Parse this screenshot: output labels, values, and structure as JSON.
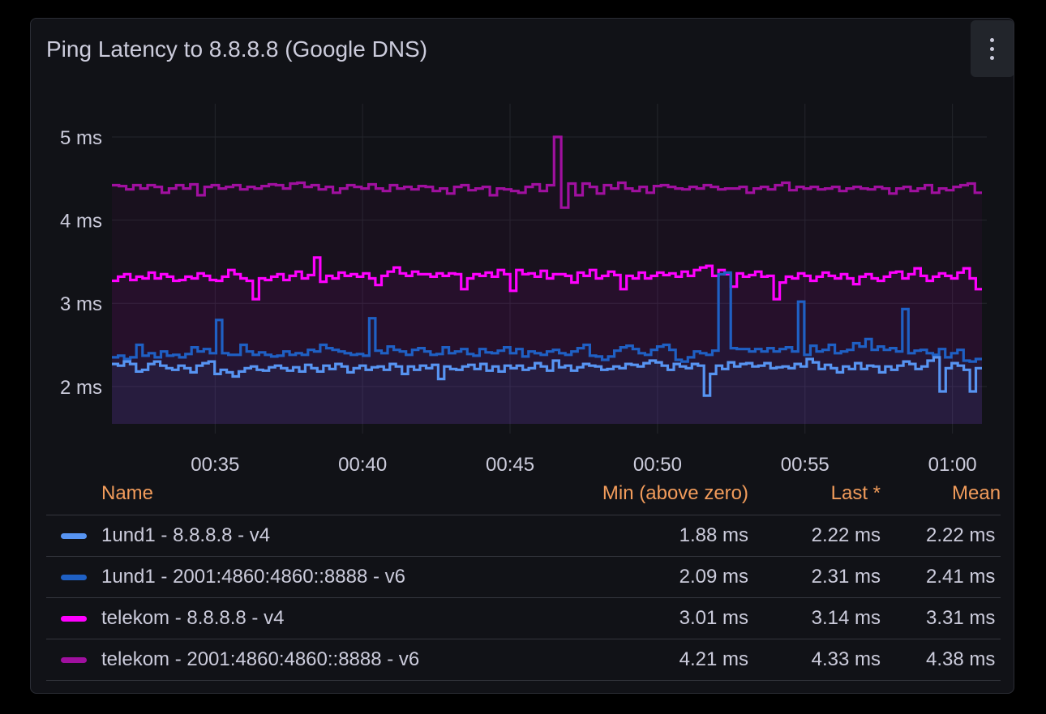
{
  "panel": {
    "title": "Ping Latency to 8.8.8.8 (Google DNS)",
    "menu_icon": "kebab-vertical-icon"
  },
  "chart_data": {
    "type": "line",
    "title": "Ping Latency to 8.8.8.8 (Google DNS)",
    "line_style": "step",
    "x_ticks": [
      "00:35",
      "00:40",
      "00:45",
      "00:50",
      "00:55",
      "01:00"
    ],
    "y_ticks": [
      "2 ms",
      "3 ms",
      "4 ms",
      "5 ms"
    ],
    "x_range_minutes": [
      "00:31:30",
      "01:01:00"
    ],
    "ylim": [
      1.55,
      5.4
    ],
    "unit": "ms",
    "grid": true,
    "legend_placement": "bottom-table",
    "series": [
      {
        "name": "1und1 - 8.8.8.8 - v4",
        "color": "#5794f2",
        "t_start": 31.5,
        "t_end": 61.0,
        "values": [
          2.27,
          2.25,
          2.3,
          2.27,
          2.18,
          2.2,
          2.27,
          2.3,
          2.25,
          2.22,
          2.2,
          2.25,
          2.22,
          2.17,
          2.25,
          2.28,
          2.3,
          2.15,
          2.2,
          2.17,
          2.12,
          2.18,
          2.22,
          2.24,
          2.2,
          2.19,
          2.23,
          2.25,
          2.22,
          2.19,
          2.23,
          2.18,
          2.26,
          2.22,
          2.18,
          2.25,
          2.21,
          2.27,
          2.24,
          2.17,
          2.22,
          2.25,
          2.2,
          2.23,
          2.24,
          2.2,
          2.27,
          2.24,
          2.15,
          2.24,
          2.2,
          2.25,
          2.22,
          2.26,
          2.09,
          2.24,
          2.21,
          2.2,
          2.24,
          2.26,
          2.21,
          2.27,
          2.19,
          2.24,
          2.18,
          2.25,
          2.22,
          2.25,
          2.2,
          2.22,
          2.28,
          2.24,
          2.19,
          2.31,
          2.23,
          2.25,
          2.19,
          2.23,
          2.27,
          2.25,
          2.24,
          2.2,
          2.21,
          2.24,
          2.22,
          2.27,
          2.26,
          2.24,
          2.28,
          2.31,
          2.29,
          2.25,
          2.2,
          2.27,
          2.24,
          2.22,
          2.27,
          2.25,
          1.89,
          2.15,
          2.25,
          2.21,
          2.29,
          2.24,
          2.27,
          2.28,
          2.24,
          2.25,
          2.28,
          2.22,
          2.23,
          2.24,
          2.22,
          2.27,
          2.24,
          2.33,
          2.29,
          2.21,
          2.26,
          2.22,
          2.17,
          2.24,
          2.21,
          2.28,
          2.21,
          2.25,
          2.24,
          2.17,
          2.24,
          2.2,
          2.25,
          2.3,
          2.27,
          2.21,
          2.24,
          2.31,
          2.35,
          1.94,
          2.22,
          2.28,
          2.25,
          2.2,
          1.94,
          2.22
        ]
      },
      {
        "name": "1und1 - 2001:4860:4860::8888 - v6",
        "color": "#1f60c4",
        "t_start": 31.5,
        "t_end": 61.0,
        "values": [
          2.35,
          2.37,
          2.33,
          2.35,
          2.5,
          2.37,
          2.4,
          2.35,
          2.42,
          2.37,
          2.38,
          2.35,
          2.39,
          2.47,
          2.42,
          2.45,
          2.4,
          2.8,
          2.4,
          2.38,
          2.38,
          2.5,
          2.42,
          2.38,
          2.41,
          2.38,
          2.36,
          2.37,
          2.42,
          2.38,
          2.4,
          2.38,
          2.44,
          2.42,
          2.5,
          2.46,
          2.44,
          2.42,
          2.4,
          2.38,
          2.39,
          2.37,
          2.82,
          2.43,
          2.4,
          2.48,
          2.44,
          2.42,
          2.38,
          2.44,
          2.46,
          2.42,
          2.38,
          2.39,
          2.47,
          2.4,
          2.42,
          2.45,
          2.39,
          2.37,
          2.45,
          2.41,
          2.4,
          2.43,
          2.47,
          2.4,
          2.45,
          2.36,
          2.42,
          2.4,
          2.38,
          2.42,
          2.44,
          2.4,
          2.38,
          2.42,
          2.46,
          2.5,
          2.37,
          2.36,
          2.32,
          2.36,
          2.43,
          2.47,
          2.49,
          2.45,
          2.4,
          2.38,
          2.44,
          2.48,
          2.5,
          2.44,
          2.32,
          2.3,
          2.35,
          2.42,
          2.4,
          2.38,
          2.43,
          3.35,
          3.37,
          2.46,
          2.45,
          2.45,
          2.42,
          2.45,
          2.42,
          2.46,
          2.42,
          2.45,
          2.47,
          2.42,
          3.02,
          2.38,
          2.49,
          2.42,
          2.44,
          2.5,
          2.4,
          2.42,
          2.44,
          2.52,
          2.48,
          2.57,
          2.44,
          2.48,
          2.44,
          2.46,
          2.42,
          2.93,
          2.4,
          2.43,
          2.44,
          2.4,
          2.38,
          2.45,
          2.35,
          2.4,
          2.44,
          2.31,
          2.3,
          2.33
        ]
      },
      {
        "name": "telekom - 8.8.8.8 - v4",
        "color": "#ff00ff",
        "t_start": 31.5,
        "t_end": 61.0,
        "values": [
          3.27,
          3.32,
          3.35,
          3.28,
          3.32,
          3.3,
          3.37,
          3.3,
          3.35,
          3.32,
          3.27,
          3.28,
          3.32,
          3.3,
          3.36,
          3.33,
          3.28,
          3.27,
          3.32,
          3.4,
          3.35,
          3.3,
          3.27,
          3.05,
          3.3,
          3.28,
          3.32,
          3.35,
          3.28,
          3.33,
          3.38,
          3.3,
          3.34,
          3.55,
          3.26,
          3.33,
          3.3,
          3.37,
          3.33,
          3.35,
          3.32,
          3.36,
          3.3,
          3.22,
          3.33,
          3.38,
          3.43,
          3.36,
          3.33,
          3.38,
          3.35,
          3.35,
          3.32,
          3.36,
          3.33,
          3.36,
          3.35,
          3.17,
          3.3,
          3.35,
          3.33,
          3.37,
          3.32,
          3.4,
          3.35,
          3.15,
          3.4,
          3.35,
          3.36,
          3.32,
          3.39,
          3.3,
          3.35,
          3.35,
          3.33,
          3.25,
          3.37,
          3.33,
          3.4,
          3.3,
          3.33,
          3.38,
          3.34,
          3.17,
          3.33,
          3.3,
          3.37,
          3.3,
          3.33,
          3.37,
          3.34,
          3.36,
          3.32,
          3.38,
          3.33,
          3.4,
          3.43,
          3.45,
          3.33,
          3.4,
          3.35,
          3.2,
          3.36,
          3.32,
          3.34,
          3.38,
          3.32,
          3.33,
          3.05,
          3.25,
          3.32,
          3.3,
          3.36,
          3.33,
          3.27,
          3.32,
          3.37,
          3.33,
          3.3,
          3.35,
          3.3,
          3.23,
          3.32,
          3.35,
          3.3,
          3.27,
          3.32,
          3.37,
          3.38,
          3.3,
          3.35,
          3.42,
          3.33,
          3.27,
          3.32,
          3.36,
          3.33,
          3.3,
          3.37,
          3.42,
          3.3,
          3.17
        ]
      },
      {
        "name": "telekom - 2001:4860:4860::8888 - v6",
        "color": "#a0109f",
        "t_start": 31.5,
        "t_end": 61.0,
        "values": [
          4.42,
          4.41,
          4.37,
          4.42,
          4.38,
          4.42,
          4.4,
          4.33,
          4.38,
          4.42,
          4.38,
          4.43,
          4.3,
          4.4,
          4.42,
          4.38,
          4.4,
          4.42,
          4.37,
          4.4,
          4.38,
          4.41,
          4.43,
          4.42,
          4.38,
          4.44,
          4.45,
          4.4,
          4.42,
          4.37,
          4.4,
          4.33,
          4.38,
          4.42,
          4.4,
          4.38,
          4.43,
          4.38,
          4.35,
          4.42,
          4.38,
          4.4,
          4.37,
          4.41,
          4.4,
          4.35,
          4.38,
          4.32,
          4.4,
          4.42,
          4.36,
          4.38,
          4.4,
          4.3,
          4.38,
          4.37,
          4.35,
          4.33,
          4.4,
          4.43,
          4.35,
          4.42,
          5.0,
          4.15,
          4.44,
          4.3,
          4.44,
          4.4,
          4.32,
          4.42,
          4.38,
          4.45,
          4.38,
          4.35,
          4.4,
          4.33,
          4.41,
          4.42,
          4.4,
          4.38,
          4.37,
          4.4,
          4.38,
          4.42,
          4.4,
          4.37,
          4.38,
          4.38,
          4.4,
          4.33,
          4.38,
          4.4,
          4.37,
          4.42,
          4.45,
          4.36,
          4.4,
          4.38,
          4.4,
          4.37,
          4.38,
          4.4,
          4.35,
          4.38,
          4.4,
          4.38,
          4.37,
          4.4,
          4.38,
          4.32,
          4.38,
          4.4,
          4.35,
          4.38,
          4.42,
          4.33,
          4.38,
          4.36,
          4.4,
          4.42,
          4.44,
          4.33
        ]
      }
    ]
  },
  "legend": {
    "headers": {
      "name": "Name",
      "min": "Min (above zero)",
      "last": "Last *",
      "mean": "Mean"
    },
    "rows": [
      {
        "name": "1und1 - 8.8.8.8 - v4",
        "color": "#5794f2",
        "min": "1.88 ms",
        "last": "2.22 ms",
        "mean": "2.22 ms"
      },
      {
        "name": "1und1 - 2001:4860:4860::8888 - v6",
        "color": "#1f60c4",
        "min": "2.09 ms",
        "last": "2.31 ms",
        "mean": "2.41 ms"
      },
      {
        "name": "telekom - 8.8.8.8 - v4",
        "color": "#ff00ff",
        "min": "3.01 ms",
        "last": "3.14 ms",
        "mean": "3.31 ms"
      },
      {
        "name": "telekom - 2001:4860:4860::8888 - v6",
        "color": "#a0109f",
        "min": "4.21 ms",
        "last": "4.33 ms",
        "mean": "4.38 ms"
      }
    ]
  }
}
